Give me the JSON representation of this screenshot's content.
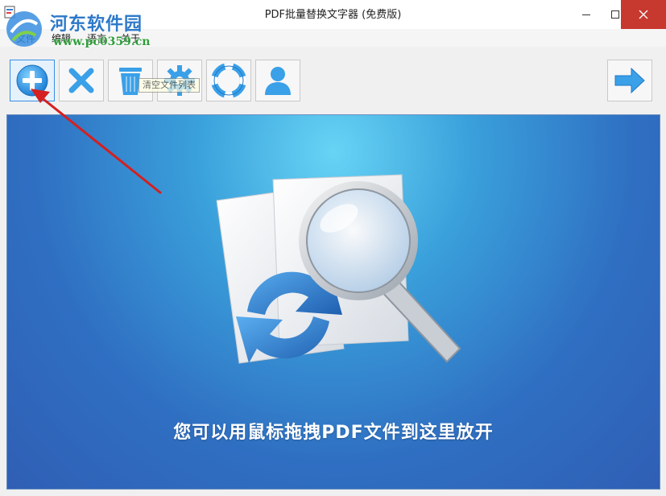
{
  "window": {
    "title": "PDF批量替换文字器 (免费版)",
    "controls": {
      "minimize": "minimize",
      "maximize": "maximize",
      "close": "close"
    }
  },
  "menu": {
    "items": [
      {
        "label": "文件"
      },
      {
        "label": "编辑"
      },
      {
        "label": "语言"
      },
      {
        "label": "关于"
      }
    ]
  },
  "watermark": {
    "name": "河东软件园",
    "url": "www.pc0359.cn"
  },
  "toolbar": {
    "buttons": [
      {
        "id": "add",
        "icon": "add-file-icon",
        "active": true
      },
      {
        "id": "remove",
        "icon": "remove-x-icon"
      },
      {
        "id": "clear",
        "icon": "trash-icon"
      },
      {
        "id": "settings",
        "icon": "gear-icon"
      },
      {
        "id": "help",
        "icon": "lifebuoy-icon"
      },
      {
        "id": "account",
        "icon": "user-icon"
      },
      {
        "id": "next",
        "icon": "arrow-right-icon"
      }
    ],
    "tooltip": "清空文件列表"
  },
  "droparea": {
    "hint": "您可以用鼠标拖拽PDF文件到这里放开",
    "illustration": "documents-magnifier-refresh-icon"
  },
  "colors": {
    "accent": "#2f7fd0",
    "close_button": "#c7382e",
    "annotation_arrow": "#d42020",
    "drop_bg_top": "#67d4f5",
    "drop_bg_bottom": "#2f5fb5"
  }
}
